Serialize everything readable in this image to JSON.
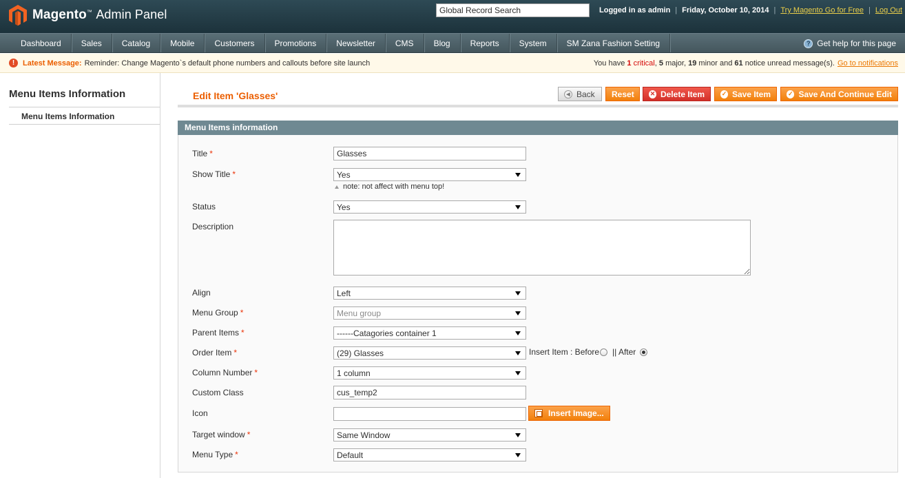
{
  "header": {
    "brand": "Magento",
    "brand_tm": "™",
    "brand_sub": "Admin Panel",
    "search_value": "Global Record Search",
    "logged_in": "Logged in as admin",
    "date": "Friday, October 10, 2014",
    "try_link": "Try Magento Go for Free",
    "logout": "Log Out",
    "separator": "|"
  },
  "nav": {
    "items": [
      "Dashboard",
      "Sales",
      "Catalog",
      "Mobile",
      "Customers",
      "Promotions",
      "Newsletter",
      "CMS",
      "Blog",
      "Reports",
      "System",
      "SM Zana Fashion Setting"
    ],
    "help": "Get help for this page",
    "help_glyph": "?"
  },
  "notice": {
    "icon_glyph": "!",
    "label": "Latest Message:",
    "message": "Reminder: Change Magento`s default phone numbers and callouts before site launch",
    "summary_1": "You have",
    "critical_count": "1",
    "critical_label": "critical",
    "summary_2": ",",
    "major_count": "5",
    "major_label": "major,",
    "minor_count": "19",
    "minor_label": "minor and",
    "notice_count": "61",
    "notice_label": "notice unread message(s).",
    "link": "Go to notifications"
  },
  "sidebar": {
    "title": "Menu Items Information",
    "item": "Menu Items Information"
  },
  "page": {
    "title": "Edit Item 'Glasses'",
    "buttons": {
      "back": "Back",
      "reset": "Reset",
      "delete": "Delete Item",
      "save": "Save Item",
      "save_continue": "Save And Continue Edit"
    },
    "panel_title": "Menu Items information"
  },
  "form": {
    "required_mark": "*",
    "title_label": "Title",
    "title_value": "Glasses",
    "show_title_label": "Show Title",
    "show_title_value": "Yes",
    "show_title_note": "note: not affect with menu top!",
    "status_label": "Status",
    "status_value": "Yes",
    "description_label": "Description",
    "description_value": "",
    "align_label": "Align",
    "align_value": "Left",
    "menu_group_label": "Menu Group",
    "menu_group_placeholder": "Menu group",
    "parent_items_label": "Parent Items",
    "parent_items_value": "------Catagories container 1",
    "order_item_label": "Order Item",
    "order_item_value": "(29) Glasses",
    "insert_item_label": "Insert Item : Before",
    "after_label": "|| After",
    "insert_position": "After",
    "column_number_label": "Column Number",
    "column_number_value": "1 column",
    "custom_class_label": "Custom Class",
    "custom_class_value": "cus_temp2",
    "icon_label": "Icon",
    "icon_value": "",
    "insert_image_button": "Insert Image...",
    "target_window_label": "Target window",
    "target_window_value": "Same Window",
    "menu_type_label": "Menu Type",
    "menu_type_value": "Default"
  },
  "colors": {
    "accent": "#eb5e00",
    "header_bg": "#253f49",
    "panel_head": "#6f8992",
    "critical": "#d40707"
  }
}
